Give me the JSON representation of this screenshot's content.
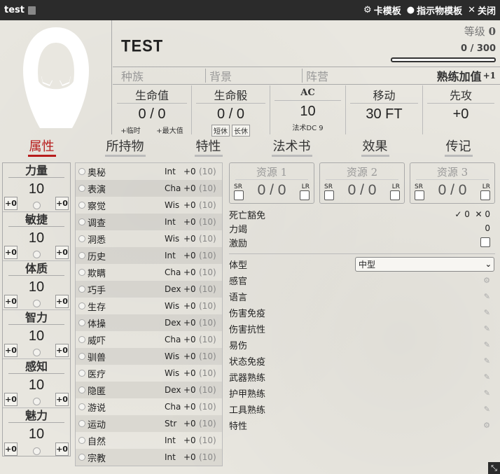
{
  "window": {
    "title": "test",
    "buttons": [
      {
        "icon": "gear-icon",
        "label": "卡模板"
      },
      {
        "icon": "user-circle-icon",
        "label": "指示物模板"
      },
      {
        "icon": "close-icon",
        "label": "关闭"
      }
    ]
  },
  "header": {
    "name": "TEST",
    "level_label": "等级",
    "level": "0",
    "xp": "0 / 300",
    "race": "种族",
    "background": "背景",
    "alignment": "阵营",
    "proficiency_label": "熟练加值",
    "proficiency": "+1"
  },
  "stats": {
    "hp": {
      "label": "生命值",
      "value": "0 / 0",
      "temp": "+临时",
      "max": "+最大值"
    },
    "hit_dice": {
      "label": "生命骰",
      "value": "0 / 0",
      "short_rest": "短休",
      "long_rest": "长休"
    },
    "ac": {
      "label": "AC",
      "value": "10",
      "sub": "法术DC 9"
    },
    "speed": {
      "label": "移动",
      "value": "30 FT"
    },
    "initiative": {
      "label": "先攻",
      "value": "+0"
    }
  },
  "tabs": [
    "属性",
    "所持物",
    "特性",
    "法术书",
    "效果",
    "传记"
  ],
  "active_tab": "属性",
  "abilities": [
    {
      "name": "力量",
      "score": "10",
      "mod": "+0",
      "save": "+0"
    },
    {
      "name": "敏捷",
      "score": "10",
      "mod": "+0",
      "save": "+0"
    },
    {
      "name": "体质",
      "score": "10",
      "mod": "+0",
      "save": "+0"
    },
    {
      "name": "智力",
      "score": "10",
      "mod": "+0",
      "save": "+0"
    },
    {
      "name": "感知",
      "score": "10",
      "mod": "+0",
      "save": "+0"
    },
    {
      "name": "魅力",
      "score": "10",
      "mod": "+0",
      "save": "+0"
    }
  ],
  "skills": [
    {
      "name": "奥秘",
      "ability": "Int",
      "mod": "+0",
      "passive": "(10)"
    },
    {
      "name": "表演",
      "ability": "Cha",
      "mod": "+0",
      "passive": "(10)"
    },
    {
      "name": "察觉",
      "ability": "Wis",
      "mod": "+0",
      "passive": "(10)"
    },
    {
      "name": "调查",
      "ability": "Int",
      "mod": "+0",
      "passive": "(10)"
    },
    {
      "name": "洞悉",
      "ability": "Wis",
      "mod": "+0",
      "passive": "(10)"
    },
    {
      "name": "历史",
      "ability": "Int",
      "mod": "+0",
      "passive": "(10)"
    },
    {
      "name": "欺瞒",
      "ability": "Cha",
      "mod": "+0",
      "passive": "(10)"
    },
    {
      "name": "巧手",
      "ability": "Dex",
      "mod": "+0",
      "passive": "(10)"
    },
    {
      "name": "生存",
      "ability": "Wis",
      "mod": "+0",
      "passive": "(10)"
    },
    {
      "name": "体操",
      "ability": "Dex",
      "mod": "+0",
      "passive": "(10)"
    },
    {
      "name": "威吓",
      "ability": "Cha",
      "mod": "+0",
      "passive": "(10)"
    },
    {
      "name": "驯兽",
      "ability": "Wis",
      "mod": "+0",
      "passive": "(10)"
    },
    {
      "name": "医疗",
      "ability": "Wis",
      "mod": "+0",
      "passive": "(10)"
    },
    {
      "name": "隐匿",
      "ability": "Dex",
      "mod": "+0",
      "passive": "(10)"
    },
    {
      "name": "游说",
      "ability": "Cha",
      "mod": "+0",
      "passive": "(10)"
    },
    {
      "name": "运动",
      "ability": "Str",
      "mod": "+0",
      "passive": "(10)"
    },
    {
      "name": "自然",
      "ability": "Int",
      "mod": "+0",
      "passive": "(10)"
    },
    {
      "name": "宗教",
      "ability": "Int",
      "mod": "+0",
      "passive": "(10)"
    }
  ],
  "resources": [
    {
      "label": "资源 1",
      "value": "0 / 0",
      "sr": "SR",
      "lr": "LR"
    },
    {
      "label": "资源 2",
      "value": "0 / 0",
      "sr": "SR",
      "lr": "LR"
    },
    {
      "label": "资源 3",
      "value": "0 / 0",
      "sr": "SR",
      "lr": "LR"
    }
  ],
  "misc": {
    "death_saves_label": "死亡豁免",
    "death_success": "0",
    "death_fail": "0",
    "exhaustion_label": "力竭",
    "exhaustion": "0",
    "inspiration_label": "激励"
  },
  "traits": {
    "size_label": "体型",
    "size_value": "中型",
    "items": [
      "感官",
      "语言",
      "伤害免疫",
      "伤害抗性",
      "易伤",
      "状态免疫",
      "武器熟练",
      "护甲熟练",
      "工具熟练",
      "特性"
    ]
  }
}
